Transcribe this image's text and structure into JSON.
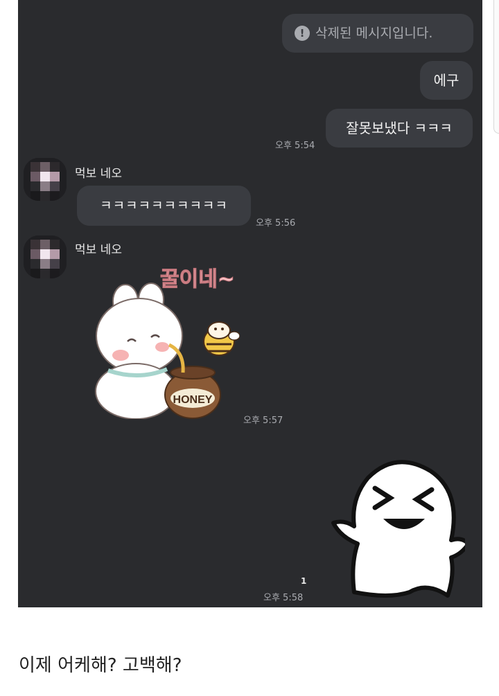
{
  "chat": {
    "messages": [
      {
        "text": "삭제된 메시지입니다."
      },
      {
        "text": "에구"
      },
      {
        "text": "잘못보냈다 ㅋㅋㅋ",
        "time": "오후 5:54"
      },
      {
        "sender": "먹보 네오",
        "text": "ㅋㅋㅋㅋㅋㅋㅋㅋㅋㅋ",
        "time": "오후 5:56"
      },
      {
        "sender": "먹보 네오",
        "sticker_text": "꿀이네~",
        "sticker_label": "HONEY",
        "time": "오후 5:57"
      },
      {
        "time": "오후 5:58",
        "read_count": "1"
      }
    ]
  },
  "caption": "이제 어케해? 고백해?"
}
